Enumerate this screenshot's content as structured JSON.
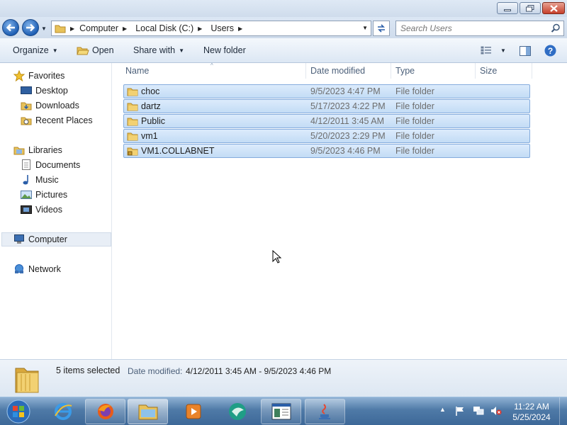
{
  "address": {
    "crumbs": [
      "Computer",
      "Local Disk (C:)",
      "Users"
    ]
  },
  "search": {
    "placeholder": "Search Users"
  },
  "toolbar": {
    "organize": "Organize",
    "open": "Open",
    "share_with": "Share with",
    "new_folder": "New folder"
  },
  "nav": {
    "favorites": "Favorites",
    "desktop": "Desktop",
    "downloads": "Downloads",
    "recent_places": "Recent Places",
    "libraries": "Libraries",
    "documents": "Documents",
    "music": "Music",
    "pictures": "Pictures",
    "videos": "Videos",
    "computer": "Computer",
    "network": "Network"
  },
  "columns": {
    "name": "Name",
    "date": "Date modified",
    "type": "Type",
    "size": "Size"
  },
  "files": [
    {
      "name": "choc",
      "date": "9/5/2023 4:47 PM",
      "type": "File folder"
    },
    {
      "name": "dartz",
      "date": "5/17/2023 4:22 PM",
      "type": "File folder"
    },
    {
      "name": "Public",
      "date": "4/12/2011 3:45 AM",
      "type": "File folder"
    },
    {
      "name": "vm1",
      "date": "5/20/2023 2:29 PM",
      "type": "File folder"
    },
    {
      "name": "VM1.COLLABNET",
      "date": "9/5/2023 4:46 PM",
      "type": "File folder"
    }
  ],
  "details": {
    "count": "5 items selected",
    "date_label": "Date modified:",
    "date_value": "4/12/2011 3:45 AM - 9/5/2023 4:46 PM"
  },
  "clock": {
    "time": "11:22 AM",
    "date": "5/25/2024"
  },
  "icons": {
    "back": "back-arrow-icon",
    "forward": "forward-arrow-icon",
    "folder": "folder-icon",
    "search": "search-icon",
    "refresh": "refresh-icon",
    "start": "windows-start-icon",
    "ie": "internet-explorer-icon",
    "firefox": "firefox-icon",
    "explorer": "explorer-icon",
    "media": "media-player-icon",
    "java": "java-icon"
  },
  "colors": {
    "selection": "#cce8ff",
    "accent": "#1f5fb4"
  }
}
